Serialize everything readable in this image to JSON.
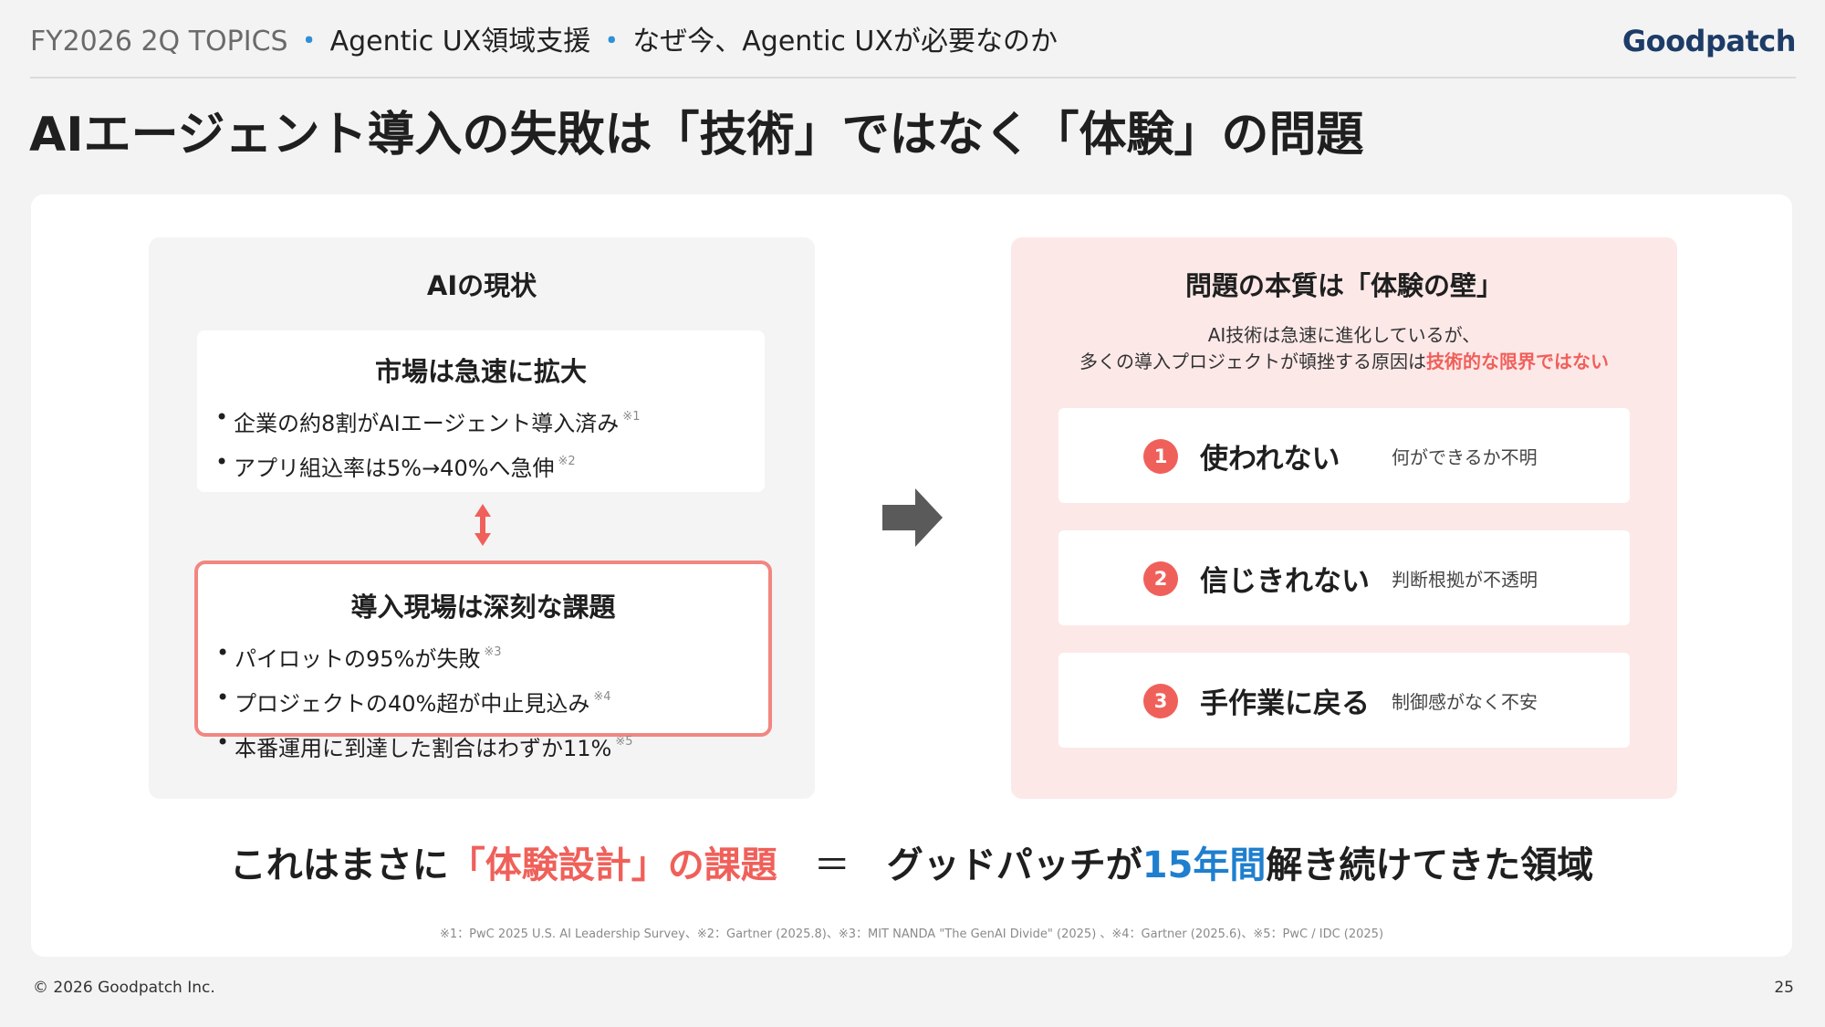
{
  "header": {
    "section": "FY2026 2Q TOPICS",
    "separator": "・",
    "subsection": "Agentic UX領域支援",
    "page": "なぜ今、Agentic UXが必要なのか",
    "logo": "Goodpatch"
  },
  "title": "AIエージェント導入の失敗は「技術」ではなく「体験」の問題",
  "left_panel": {
    "title": "AIの現状",
    "market": {
      "title": "市場は急速に拡大",
      "items": [
        {
          "text": "企業の約8割がAIエージェント導入済み",
          "note": "※1"
        },
        {
          "text": "アプリ組込率は5%→40%へ急伸",
          "note": "※2"
        }
      ]
    },
    "issues": {
      "title": "導入現場は深刻な課題",
      "items": [
        {
          "text": "パイロットの95%が失敗",
          "note": "※3"
        },
        {
          "text": "プロジェクトの40%超が中止見込み",
          "note": "※4"
        },
        {
          "text": "本番運用に到達した割合はわずか11%",
          "note": "※5"
        }
      ]
    }
  },
  "right_panel": {
    "title": "問題の本質は「体験の壁」",
    "desc_line1": "AI技術は急速に進化しているが、",
    "desc_line2_pre": "多くの導入プロジェクトが頓挫する原因は",
    "desc_line2_highlight": "技術的な限界ではない",
    "reasons": [
      {
        "num": "1",
        "label": "使われない",
        "detail": "何ができるか不明"
      },
      {
        "num": "2",
        "label": "信じきれない",
        "detail": "判断根拠が不透明"
      },
      {
        "num": "3",
        "label": "手作業に戻る",
        "detail": "制御感がなく不安"
      }
    ]
  },
  "conclusion": {
    "pre": "これはまさに",
    "highlight": "「体験設計」の課題",
    "equals": "＝",
    "post1": "グッドパッチが",
    "highlight2": "15年間",
    "post2": "解き続けてきた領域"
  },
  "footnotes": "※1：PwC 2025 U.S. AI Leadership Survey、※2：Gartner (2025.8)、※3：MIT NANDA \"The GenAI Divide\" (2025) 、※4：Gartner (2025.6)、※5：PwC / IDC (2025)",
  "footer": {
    "copyright": "© 2026 Goodpatch Inc.",
    "page_number": "25"
  },
  "colors": {
    "accent_red": "#f0605a",
    "accent_blue": "#1f7fcf",
    "dot_blue": "#2f8fd8",
    "logo_navy": "#1d3c67"
  },
  "icons": [
    "up-down-arrow-icon",
    "right-arrow-icon"
  ]
}
